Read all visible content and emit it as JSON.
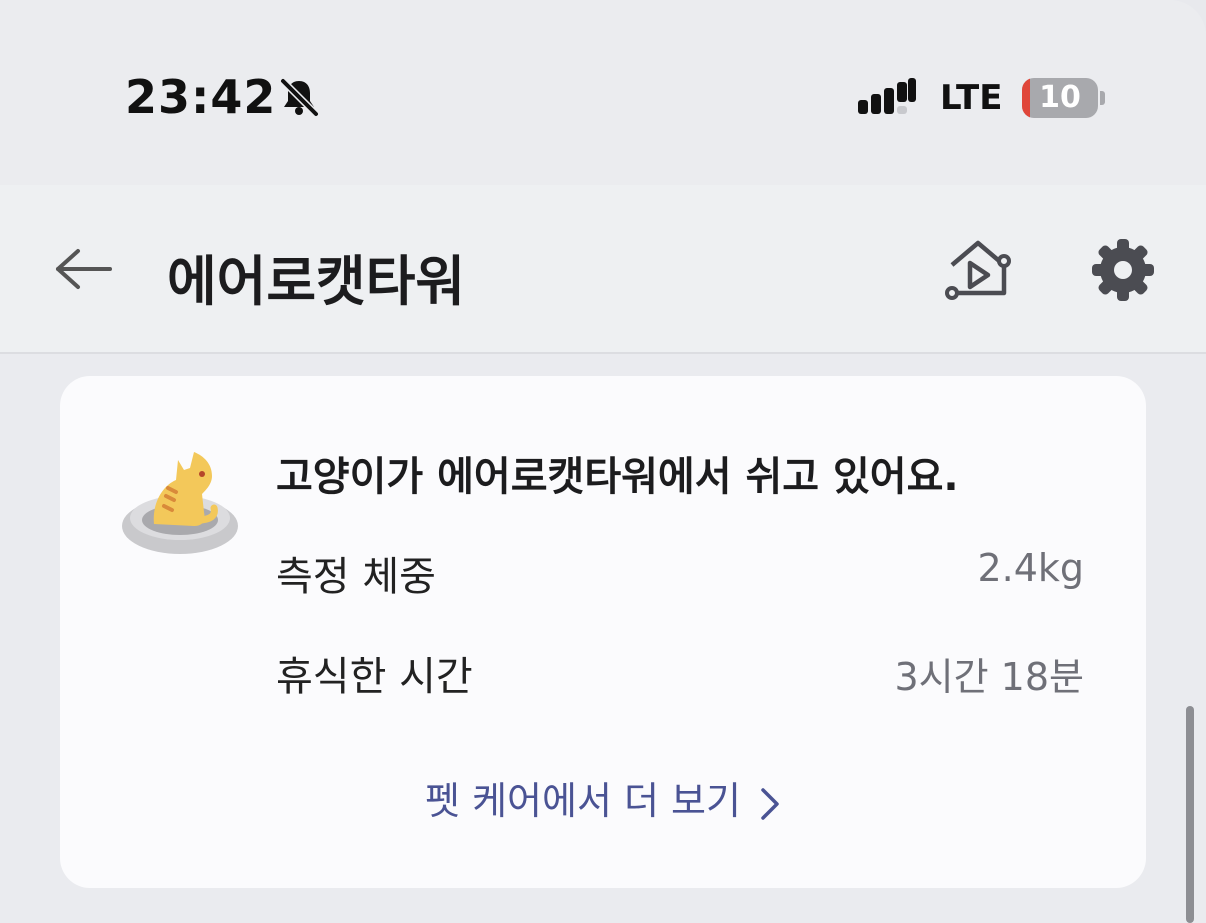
{
  "status_bar": {
    "time": "23:42",
    "network": "LTE",
    "battery": "10",
    "battery_level": 0.1,
    "icons": [
      "bell-muted-icon",
      "signal-icon"
    ]
  },
  "header": {
    "title": "에어로캣타워",
    "icons": [
      "back-arrow-icon",
      "home-play-icon",
      "gear-icon"
    ]
  },
  "card": {
    "title": "고양이가 에어로캣타워에서 쉬고 있어요.",
    "icon": "cat-bed-icon",
    "rows": [
      {
        "label": "측정 체중",
        "value": "2.4kg"
      },
      {
        "label": "휴식한 시간",
        "value": "3시간 18분"
      }
    ],
    "more_link": "펫 케어에서 더 보기"
  },
  "colors": {
    "background": "#eaebef",
    "card": "#fbfbfd",
    "link": "#4a5394",
    "secondary_text": "#6f7078",
    "battery_low": "#e0463a"
  }
}
